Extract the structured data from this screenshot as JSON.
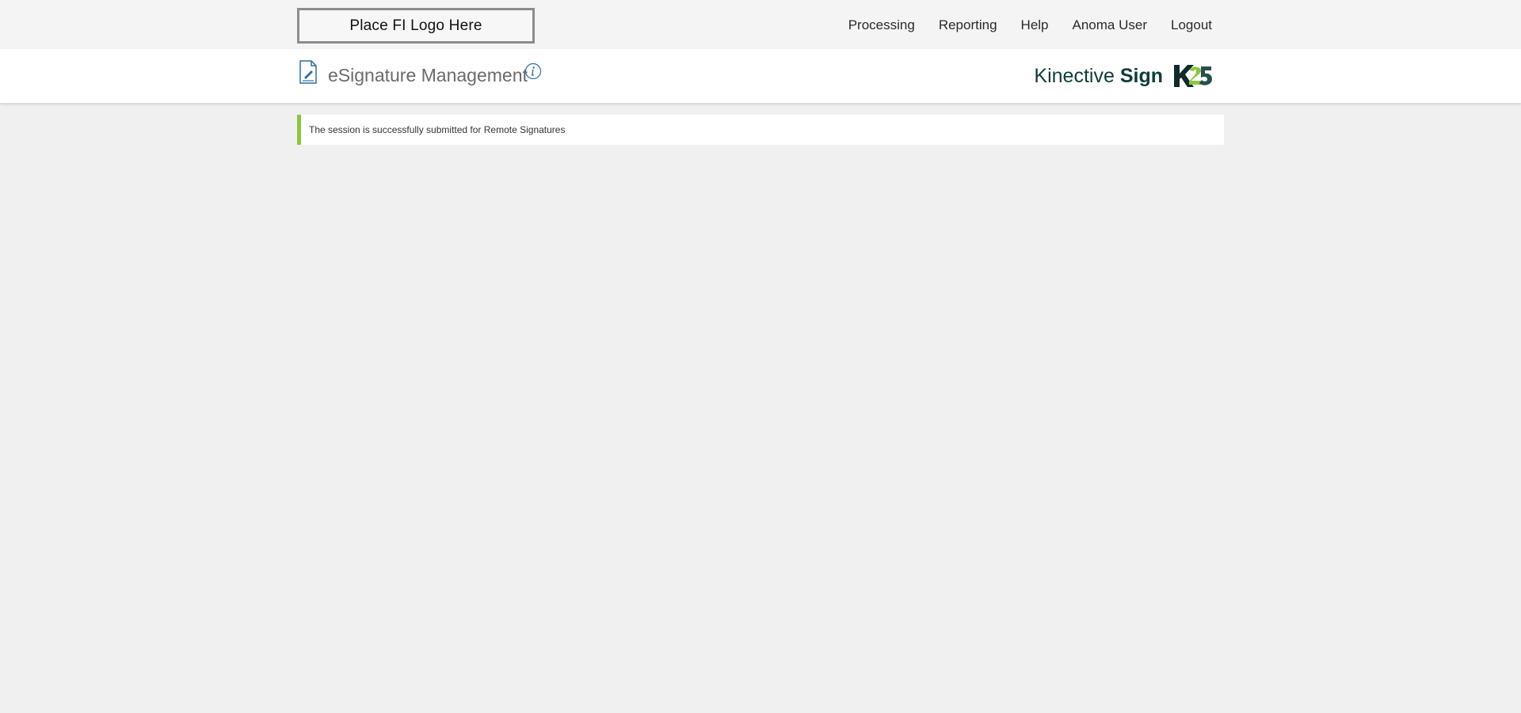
{
  "header": {
    "logo_placeholder": "Place FI Logo Here",
    "nav": [
      {
        "label": "Processing"
      },
      {
        "label": "Reporting"
      },
      {
        "label": "Help"
      },
      {
        "label": "Anoma User"
      },
      {
        "label": "Logout"
      }
    ]
  },
  "titlebar": {
    "title": "eSignature Management",
    "doc_icon": "document-signature-icon",
    "info_icon": "info-icon",
    "brand": {
      "name_regular": "Kinective",
      "name_bold": "Sign",
      "mark_icon": "k25-logo"
    }
  },
  "alert": {
    "message": "The session is successfully submitted for Remote Signatures",
    "status": "success",
    "accent_color": "#8cc63f"
  },
  "colors": {
    "brand_dark": "#0f3d3a",
    "brand_green": "#8cc63f",
    "icon_blue": "#2f6f9f"
  }
}
